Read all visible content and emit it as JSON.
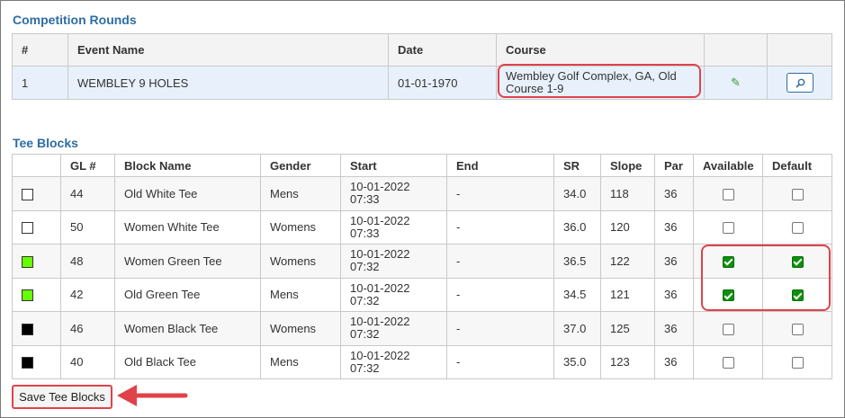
{
  "rounds": {
    "title": "Competition Rounds",
    "headers": [
      "#",
      "Event Name",
      "Date",
      "Course",
      "",
      ""
    ],
    "rows": [
      {
        "num": "1",
        "event": "WEMBLEY 9 HOLES",
        "date": "01-01-1970",
        "course": "Wembley Golf Complex, GA, Old Course 1-9",
        "edit_icon": "pencil-icon",
        "view_icon": "search-icon"
      }
    ]
  },
  "tees": {
    "title": "Tee Blocks",
    "headers": [
      "",
      "GL #",
      "Block Name",
      "Gender",
      "Start",
      "End",
      "SR",
      "Slope",
      "Par",
      "Available",
      "Default"
    ],
    "rows": [
      {
        "color": "#ffffff",
        "gl": "44",
        "name": "Old White Tee",
        "gender": "Mens",
        "start_date": "10-01-2022",
        "start_time": "07:33",
        "end": "-",
        "sr": "34.0",
        "slope": "118",
        "par": "36",
        "available": false,
        "default": false
      },
      {
        "color": "#ffffff",
        "gl": "50",
        "name": "Women White Tee",
        "gender": "Womens",
        "start_date": "10-01-2022",
        "start_time": "07:33",
        "end": "-",
        "sr": "36.0",
        "slope": "120",
        "par": "36",
        "available": false,
        "default": false
      },
      {
        "color": "#66ff00",
        "gl": "48",
        "name": "Women Green Tee",
        "gender": "Womens",
        "start_date": "10-01-2022",
        "start_time": "07:32",
        "end": "-",
        "sr": "36.5",
        "slope": "122",
        "par": "36",
        "available": true,
        "default": true
      },
      {
        "color": "#66ff00",
        "gl": "42",
        "name": "Old Green Tee",
        "gender": "Mens",
        "start_date": "10-01-2022",
        "start_time": "07:32",
        "end": "-",
        "sr": "34.5",
        "slope": "121",
        "par": "36",
        "available": true,
        "default": true
      },
      {
        "color": "#000000",
        "gl": "46",
        "name": "Women Black Tee",
        "gender": "Womens",
        "start_date": "10-01-2022",
        "start_time": "07:32",
        "end": "-",
        "sr": "37.0",
        "slope": "125",
        "par": "36",
        "available": false,
        "default": false
      },
      {
        "color": "#000000",
        "gl": "40",
        "name": "Old Black Tee",
        "gender": "Mens",
        "start_date": "10-01-2022",
        "start_time": "07:32",
        "end": "-",
        "sr": "35.0",
        "slope": "123",
        "par": "36",
        "available": false,
        "default": false
      }
    ]
  },
  "save_button_label": "Save Tee Blocks",
  "colors": {
    "accent": "#2e6da4",
    "highlight": "#e0424a",
    "checked": "#0f8f0f",
    "selected_row": "#e8f1fb"
  }
}
